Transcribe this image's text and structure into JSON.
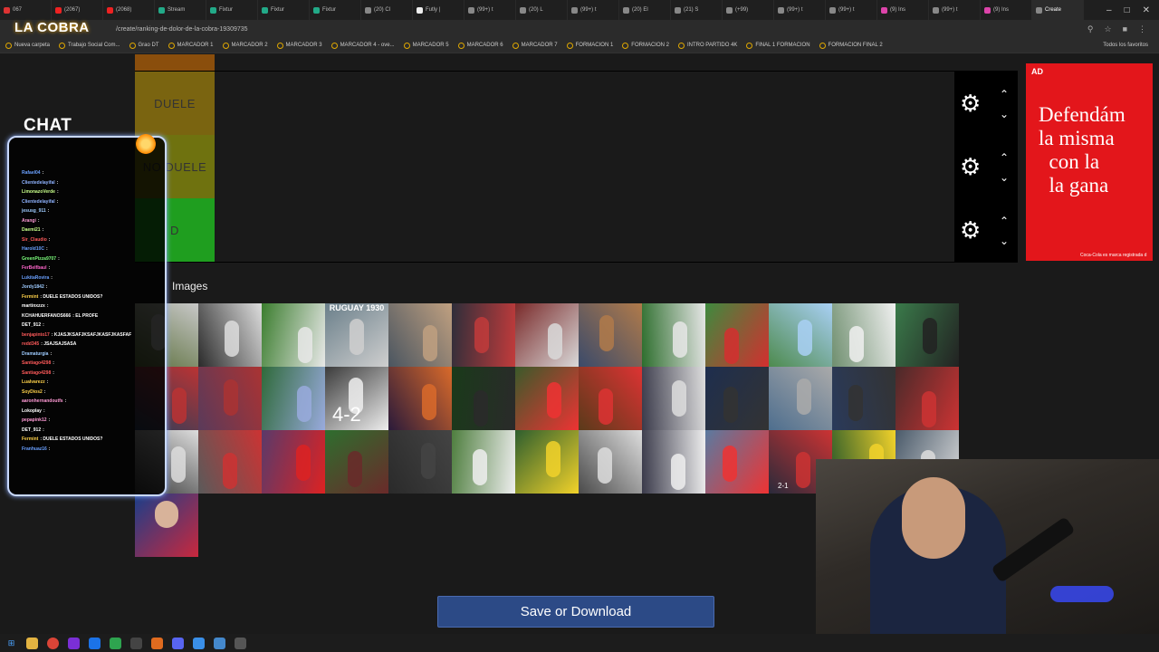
{
  "browser": {
    "tabs": [
      {
        "label": "067",
        "color": "#d33"
      },
      {
        "label": "(2067)",
        "color": "#e22"
      },
      {
        "label": "(2068)",
        "color": "#e22"
      },
      {
        "label": "Stream",
        "color": "#2a8"
      },
      {
        "label": "Fixtur",
        "color": "#2a8"
      },
      {
        "label": "Fixtur",
        "color": "#2a8"
      },
      {
        "label": "Fixtur",
        "color": "#2a8"
      },
      {
        "label": "(20) Cl",
        "color": "#888"
      },
      {
        "label": "Futly |",
        "color": "#eee"
      },
      {
        "label": "(99+) t",
        "color": "#888"
      },
      {
        "label": "(20) L",
        "color": "#888"
      },
      {
        "label": "(99+) t",
        "color": "#888"
      },
      {
        "label": "(20) El",
        "color": "#888"
      },
      {
        "label": "(21) S",
        "color": "#888"
      },
      {
        "label": "(+99)",
        "color": "#888"
      },
      {
        "label": "(99+) t",
        "color": "#888"
      },
      {
        "label": "(99+) t",
        "color": "#888"
      },
      {
        "label": "(9) Ins",
        "color": "#d4a"
      },
      {
        "label": "(99+) t",
        "color": "#888"
      },
      {
        "label": "(9) Ins",
        "color": "#d4a"
      },
      {
        "label": "Create",
        "color": "#888"
      }
    ],
    "url": "/create/ranking-de-dolor-de-la-cobra-19309735",
    "bookmarks": [
      "Nueva carpeta",
      "Trabajo Social Com...",
      "Grao DT",
      "MARCADOR 1",
      "MARCADOR 2",
      "MARCADOR 3",
      "MARCADOR 4 - ove...",
      "MARCADOR 5",
      "MARCADOR 6",
      "MARCADOR 7",
      "FORMACION 1",
      "FORMACION 2",
      "INTRO PARTIDO 4K",
      "FINAL 1 FORMACION",
      "FORMACION FINAL 2"
    ],
    "bookmarks_right": "Todos los favoritos"
  },
  "tiers": [
    {
      "label": "DUELE",
      "color": "#7a6410"
    },
    {
      "label": "NO DUELE",
      "color": "#6f720f"
    },
    {
      "label": "D",
      "color": "#1f9e1f"
    }
  ],
  "ad": {
    "tag": "AD",
    "text": "Defendám\nla misma\n  con la\n  la gana",
    "footer": "Coca-Cola es marca registrada d"
  },
  "pool": {
    "title": "Images",
    "tile_captions": {
      "uruguay": "RUGUAY 1930",
      "score": "4-2",
      "score2": "2-1"
    }
  },
  "save_label": "Save or Download",
  "overlay": {
    "logo": "LA COBRA",
    "chat_title": "CHAT",
    "chat": [
      {
        "user": "Rafael04",
        "msg": ":",
        "color": "#6aa0ff"
      },
      {
        "user": "Clientedelayifal",
        "msg": ":",
        "color": "#8fb3ff"
      },
      {
        "user": "LimonazoVerde",
        "msg": ":",
        "color": "#c8ff8a"
      },
      {
        "user": "Clientedelayifal",
        "msg": ":",
        "color": "#8fb3ff"
      },
      {
        "user": "jesusg_911",
        "msg": ":",
        "color": "#9ecbff"
      },
      {
        "user": "Arangi",
        "msg": ":",
        "color": "#ff9ad5"
      },
      {
        "user": "Daemi21",
        "msg": ":",
        "color": "#c8ff8a"
      },
      {
        "user": "Sir_Claudio",
        "msg": ":",
        "color": "#ff5a5a"
      },
      {
        "user": "Harold10C",
        "msg": ":",
        "color": "#6aa0ff"
      },
      {
        "user": "GreenPizza9707",
        "msg": ":",
        "color": "#7dff7d"
      },
      {
        "user": "FerBelfbaul",
        "msg": ":",
        "color": "#ff66cc"
      },
      {
        "user": "LukitaRovira",
        "msg": ":",
        "color": "#6aa0ff"
      },
      {
        "user": "Jordy1842",
        "msg": ":",
        "color": "#9ecbff"
      },
      {
        "user": "Fermint",
        "msg": ": DUELE ESTADOS UNIDOS?",
        "color": "#ffd24a"
      },
      {
        "user": "martinxzzx",
        "msg": ":",
        "color": "#ffffff"
      },
      {
        "user": "KCHAHUERFANOS666",
        "msg": ": EL PROFE",
        "color": "#ffffff"
      },
      {
        "user": "DET_912",
        "msg": ":",
        "color": "#ffffff"
      },
      {
        "user": "benjapinto17",
        "msg": ": KJASJKSAFJKSAFJKASFJKASFAF",
        "color": "#ff5a5a"
      },
      {
        "user": "redd345",
        "msg": ": JSAJSAJSASA",
        "color": "#ff5a5a"
      },
      {
        "user": "Dramaturgia",
        "msg": ":",
        "color": "#9ecbff"
      },
      {
        "user": "Santiago4298",
        "msg": ":",
        "color": "#ff5a5a"
      },
      {
        "user": "Santiago4298",
        "msg": ":",
        "color": "#ff5a5a"
      },
      {
        "user": "Lualvarezz",
        "msg": ":",
        "color": "#ffd24a"
      },
      {
        "user": "SoyDios2",
        "msg": ":",
        "color": "#ffd24a"
      },
      {
        "user": "aaronhernandoutfs",
        "msg": ":",
        "color": "#ff9ad5"
      },
      {
        "user": "Lokoplay",
        "msg": ":",
        "color": "#ffffff"
      },
      {
        "user": "pepapink12",
        "msg": ":",
        "color": "#ff9ad5"
      },
      {
        "user": "DET_912",
        "msg": ":",
        "color": "#ffffff"
      },
      {
        "user": "Fermint",
        "msg": ": DUELE ESTADOS UNIDOS?",
        "color": "#ffd24a"
      },
      {
        "user": "Franhuaz16",
        "msg": ":",
        "color": "#6aa0ff"
      }
    ]
  }
}
